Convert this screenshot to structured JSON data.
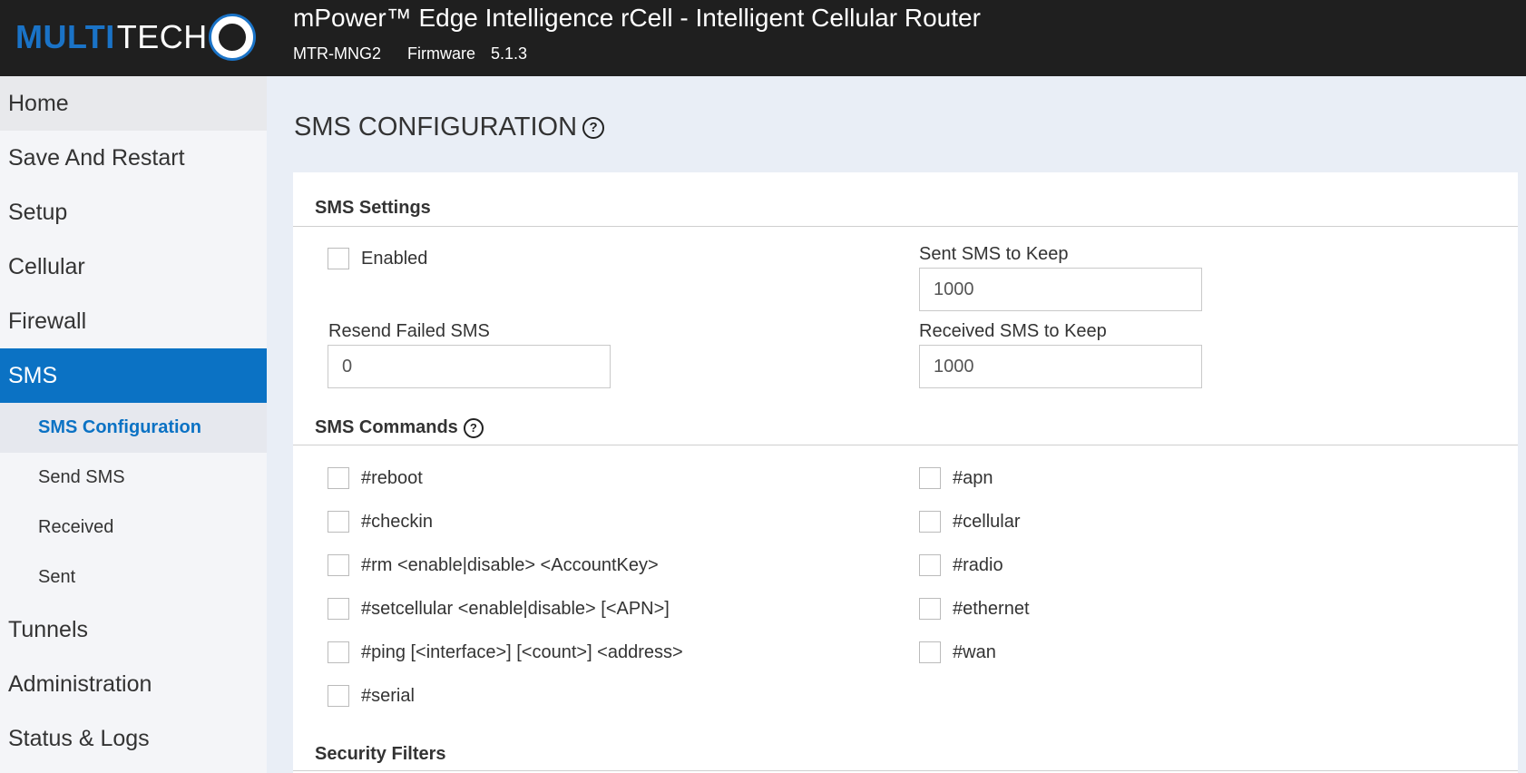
{
  "header": {
    "logo_part1": "MULTI",
    "logo_part2": "TECH",
    "title": "mPower™ Edge Intelligence rCell - Intelligent Cellular Router",
    "model": "MTR-MNG2",
    "firmware_label": "Firmware",
    "firmware_version": "5.1.3"
  },
  "sidebar": {
    "items": [
      {
        "label": "Home"
      },
      {
        "label": "Save And Restart"
      },
      {
        "label": "Setup"
      },
      {
        "label": "Cellular"
      },
      {
        "label": "Firewall"
      },
      {
        "label": "SMS"
      },
      {
        "label": "Tunnels"
      },
      {
        "label": "Administration"
      },
      {
        "label": "Status & Logs"
      }
    ],
    "sms_subitems": [
      {
        "label": "SMS Configuration"
      },
      {
        "label": "Send SMS"
      },
      {
        "label": "Received"
      },
      {
        "label": "Sent"
      }
    ]
  },
  "page": {
    "title": "SMS CONFIGURATION",
    "help_symbol": "?"
  },
  "sms_settings": {
    "title": "SMS Settings",
    "enabled_label": "Enabled",
    "resend_failed_label": "Resend Failed SMS",
    "resend_failed_value": "0",
    "sent_keep_label": "Sent SMS to Keep",
    "sent_keep_value": "1000",
    "received_keep_label": "Received SMS to Keep",
    "received_keep_value": "1000"
  },
  "sms_commands": {
    "title": "SMS Commands",
    "left": [
      "#reboot",
      "#checkin",
      "#rm <enable|disable> <AccountKey>",
      "#setcellular <enable|disable> [<APN>]",
      "#ping [<interface>] [<count>] <address>",
      "#serial"
    ],
    "right": [
      "#apn",
      "#cellular",
      "#radio",
      "#ethernet",
      "#wan"
    ]
  },
  "security_filters": {
    "title": "Security Filters"
  }
}
